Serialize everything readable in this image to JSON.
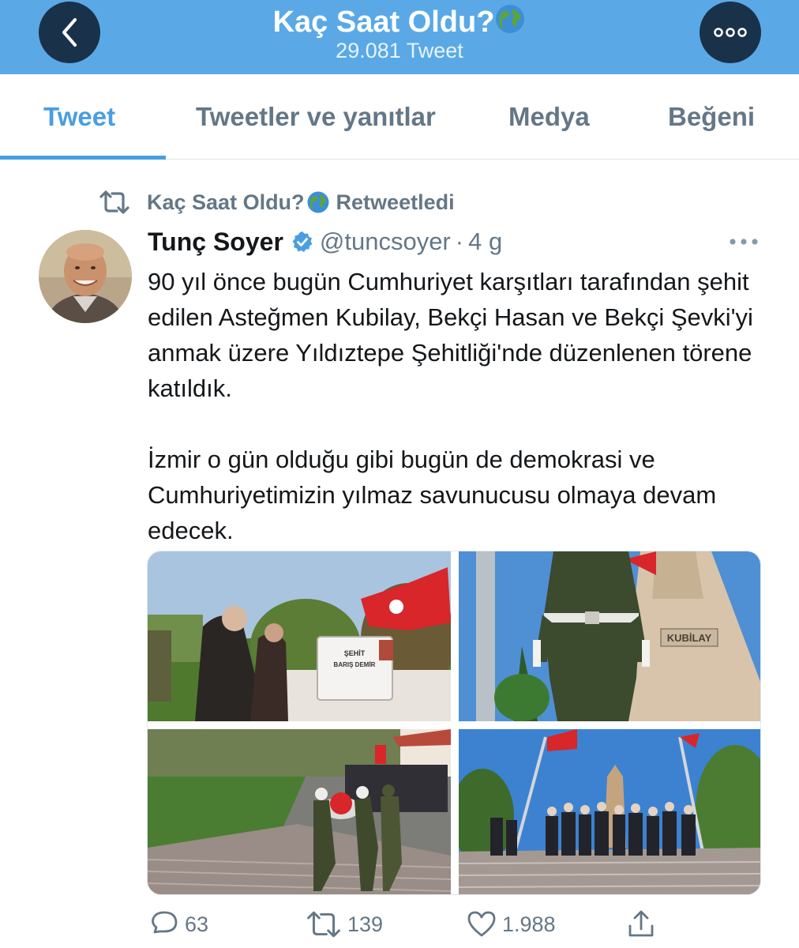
{
  "header": {
    "title": "Kaç Saat Oldu?",
    "tweet_count": "29.081 Tweet",
    "colors": {
      "bar": "#5aa9e6",
      "button": "#19324a"
    }
  },
  "tabs": [
    {
      "label": "Tweet",
      "active": true
    },
    {
      "label": "Tweetler ve yanıtlar",
      "active": false
    },
    {
      "label": "Medya",
      "active": false
    },
    {
      "label": "Beğeni",
      "active": false
    }
  ],
  "retweet_notice": {
    "user": "Kaç Saat Oldu?",
    "action": "Retweetledi"
  },
  "tweet": {
    "author": "Tunç Soyer",
    "verified": true,
    "handle": "@tuncsoyer",
    "separator": "·",
    "time": "4 g",
    "paragraphs": [
      "90 yıl önce bugün Cumhuriyet karşıtları tarafından şehit edilen Asteğmen Kubilay, Bekçi Hasan ve Bekçi Şevki'yi anmak üzere Yıldıztepe Şehitliği'nde düzenlenen törene katıldık.",
      "İzmir o gün olduğu gibi bugün de demokrasi ve Cumhuriyetimizin yılmaz savunucusu olmaya devam edecek."
    ],
    "media": [
      {
        "headstone_line1": "ŞEHİT",
        "headstone_line2": "BARIŞ DEMİR"
      },
      {
        "monument_label": "KUBİLAY"
      },
      {},
      {}
    ]
  },
  "actions": {
    "replies": "63",
    "retweets": "139",
    "likes": "1.988"
  },
  "icons": [
    "chevron-left-icon",
    "more-icon",
    "globe-icon",
    "retweet-icon",
    "verified-badge-icon",
    "reply-icon",
    "heart-icon",
    "share-icon"
  ]
}
